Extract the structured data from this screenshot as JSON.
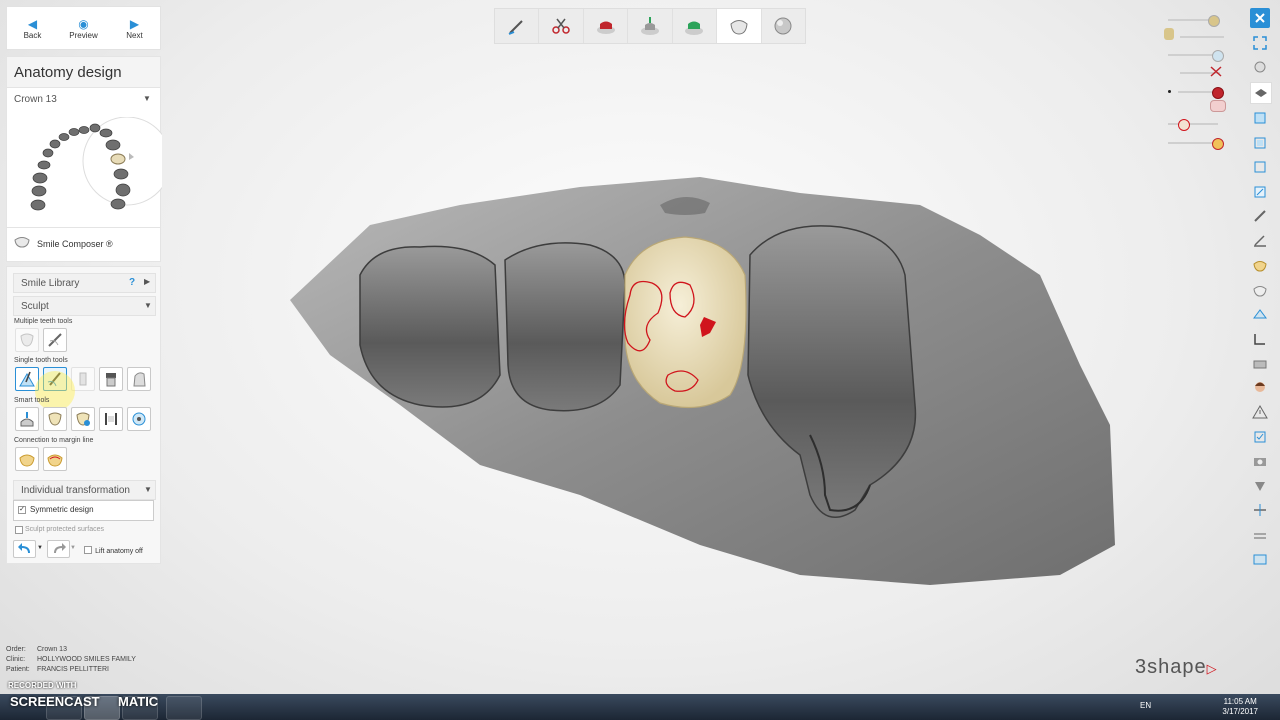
{
  "nav": {
    "back": "Back",
    "preview": "Preview",
    "next": "Next"
  },
  "panel": {
    "title": "Anatomy design",
    "crown_select": "Crown 13",
    "smile_composer": "Smile Composer ®"
  },
  "tools": {
    "smile_library": "Smile Library",
    "help_label": "?",
    "sculpt": "Sculpt",
    "multiple_teeth": "Multiple teeth tools",
    "single_tooth": "Single tooth tools",
    "smart_tools": "Smart tools",
    "connection": "Connection to margin line",
    "individual_transform": "Individual transformation",
    "symmetric": "Symmetric design",
    "sculpt_protected": "Sculpt protected surfaces",
    "lift_anatomy": "Lift anatomy off"
  },
  "info": {
    "order_key": "Order:",
    "order": "Crown 13",
    "clinic_key": "Clinic:",
    "clinic": "HOLLYWOOD SMILES FAMILY",
    "patient_key": "Patient:",
    "patient": "FRANCIS PELLITTERI"
  },
  "brand": "3shape",
  "watermark": {
    "line1": "RECORDED WITH",
    "line2": "SCREENCAST",
    "line3": "MATIC"
  },
  "taskbar": {
    "lang": "EN",
    "time": "11:05 AM",
    "date": "3/17/2017"
  },
  "colors": {
    "accent": "#2a8fd6",
    "margin_line": "#d0141c",
    "crown": "#ece2c2"
  }
}
